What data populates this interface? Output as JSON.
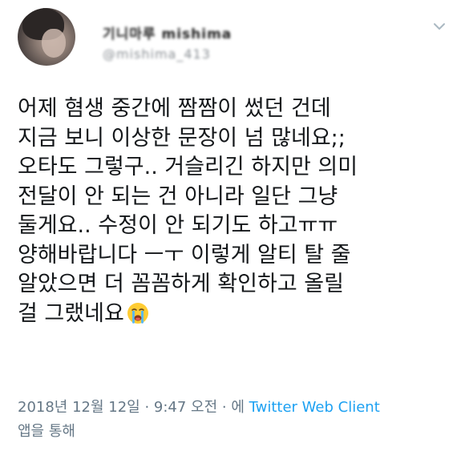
{
  "user": {
    "display_name": "기니마루 mishima",
    "handle": "@mishima_413"
  },
  "tweet": {
    "lines": [
      "어제 혐생 중간에 짬짬이 썼던 건데",
      "지금 보니 이상한 문장이 넘 많네요;;",
      "오타도 그렇구.. 거슬리긴 하지만 의미",
      "전달이 안 되는 건 아니라 일단 그냥",
      "둘게요.. 수정이 안 되기도 하고ㅠㅠ",
      "양해바랍니다 ㅡㅜ 이렇게 알티 탈 줄",
      "알았으면 더 꼼꼼하게 확인하고 올릴",
      "걸 그랬네요"
    ],
    "emoji": "loudly-crying-face"
  },
  "meta": {
    "timestamp": "2018년 12월 12일 · 9:47 오전 · 에 ",
    "source_link": "Twitter Web Client",
    "suffix": "앱을 통해"
  },
  "icons": {
    "caret": "chevron-down-icon"
  },
  "colors": {
    "link": "#1da1f2",
    "meta": "#657786",
    "text": "#14171a"
  }
}
